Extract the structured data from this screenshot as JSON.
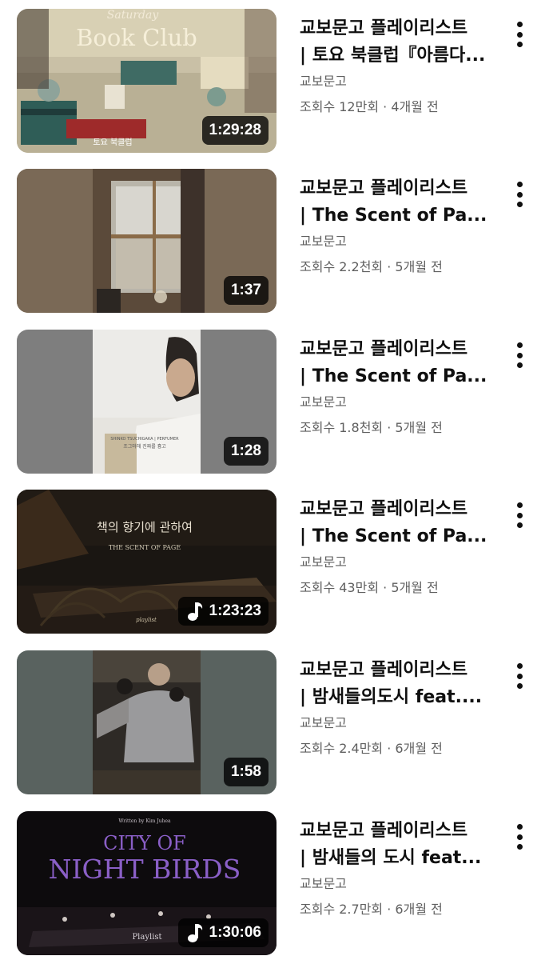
{
  "videos": [
    {
      "title_line1": "교보문고 플레이리스트",
      "title_line2": "| 토요 북클럽『아름다...",
      "channel": "교보문고",
      "views": "조회수 12만회",
      "sep": "·",
      "age": "4개월 전",
      "duration": "1:29:28",
      "playlist_icon": false,
      "thumb_text": {
        "script": "Saturday",
        "main": "Book Club",
        "caption": "토요 북클럽"
      }
    },
    {
      "title_line1": "교보문고 플레이리스트",
      "title_line2": "| The Scent of Pa...",
      "channel": "교보문고",
      "views": "조회수 2.2천회",
      "sep": "·",
      "age": "5개월 전",
      "duration": "1:37",
      "playlist_icon": false
    },
    {
      "title_line1": "교보문고 플레이리스트",
      "title_line2": "| The Scent of Pa...",
      "channel": "교보문고",
      "views": "조회수 1.8천회",
      "sep": "·",
      "age": "5개월 전",
      "duration": "1:28",
      "playlist_icon": false,
      "thumb_text": {
        "caption1": "SHINKO TSUCHIGAKA | PERFUMER",
        "caption2": "조그마해 진짜를 흉고"
      }
    },
    {
      "title_line1": "교보문고 플레이리스트",
      "title_line2": "| The Scent of Pa...",
      "channel": "교보문고",
      "views": "조회수 43만회",
      "sep": "·",
      "age": "5개월 전",
      "duration": "1:23:23",
      "playlist_icon": true,
      "thumb_text": {
        "korean": "책의 향기에 관하여",
        "english": "THE SCENT OF PAGE",
        "small": "playlist"
      }
    },
    {
      "title_line1": "교보문고 플레이리스트",
      "title_line2": "| 밤새들의도시 feat....",
      "channel": "교보문고",
      "views": "조회수 2.4만회",
      "sep": "·",
      "age": "6개월 전",
      "duration": "1:58",
      "playlist_icon": false
    },
    {
      "title_line1": "교보문고 플레이리스트",
      "title_line2": "| 밤새들의 도시 feat...",
      "channel": "교보문고",
      "views": "조회수 2.7만회",
      "sep": "·",
      "age": "6개월 전",
      "duration": "1:30:06",
      "playlist_icon": true,
      "thumb_text": {
        "credit": "Written by Kim Juhea",
        "line1": "CITY OF",
        "line2": "NIGHT BIRDS",
        "small": "Playlist"
      }
    }
  ],
  "colors": {
    "text": "#0f0f0f",
    "secondary": "#606060",
    "badge": "#000000c7",
    "night_birds_purple": "#8a5fc7"
  }
}
